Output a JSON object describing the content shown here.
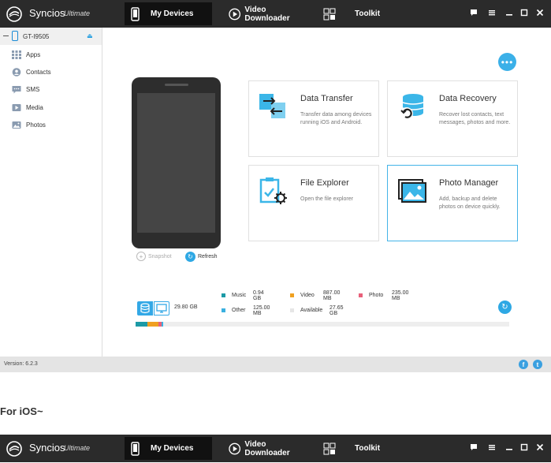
{
  "app": {
    "title": "Syncios",
    "subtitle": "Ultimate"
  },
  "tabs": [
    {
      "label": "My Devices",
      "icon": "phone-icon",
      "active": true
    },
    {
      "label": "Video Downloader",
      "icon": "play-icon",
      "active": false
    },
    {
      "label": "Toolkit",
      "icon": "grid-icon",
      "active": false
    }
  ],
  "window_controls": [
    "chat-icon",
    "menu-icon",
    "minimize-icon",
    "maximize-icon",
    "close-icon"
  ],
  "sidebar": {
    "device": {
      "name": "GT-I9505",
      "icon": "phone-icon"
    },
    "items": [
      {
        "label": "Apps",
        "icon": "apps-grid-icon"
      },
      {
        "label": "Contacts",
        "icon": "contacts-icon"
      },
      {
        "label": "SMS",
        "icon": "sms-icon"
      },
      {
        "label": "Media",
        "icon": "media-icon"
      },
      {
        "label": "Photos",
        "icon": "photos-icon"
      }
    ]
  },
  "phone_actions": {
    "snapshot": "Snapshot",
    "refresh": "Refresh"
  },
  "cards": [
    {
      "title": "Data Transfer",
      "desc": "Transfer data among devices running iOS and Android.",
      "icon": "data-transfer-icon"
    },
    {
      "title": "Data Recovery",
      "desc": "Recover lost contacts, text messages, photos and more.",
      "icon": "data-recovery-icon"
    },
    {
      "title": "File Explorer",
      "desc": "Open the file explorer",
      "icon": "file-explorer-icon"
    },
    {
      "title": "Photo Manager",
      "desc": "Add, backup and delete photos on device quickly.",
      "icon": "photo-manager-icon"
    }
  ],
  "storage": {
    "total": "29.80 GB",
    "legend": [
      {
        "label": "Music",
        "value": "0.94 GB",
        "color": "#1c9aa6"
      },
      {
        "label": "Video",
        "value": "887.00 MB",
        "color": "#f0a020"
      },
      {
        "label": "Photo",
        "value": "235.00 MB",
        "color": "#e8607a"
      },
      {
        "label": "Other",
        "value": "125.00 MB",
        "color": "#3ab0e0"
      },
      {
        "label": "Available",
        "value": "27.65 GB",
        "color": "#e6e6e6"
      }
    ],
    "used_fractions": {
      "music": 0.0315,
      "video": 0.0291,
      "photo": 0.0077,
      "other": 0.0041
    }
  },
  "status": {
    "version": "Version: 6.2.3"
  },
  "social": [
    "facebook-icon",
    "twitter-icon"
  ],
  "section_heading": "For iOS~",
  "colors": {
    "accent": "#2ea8e4",
    "topbar": "#2b2b2b"
  }
}
